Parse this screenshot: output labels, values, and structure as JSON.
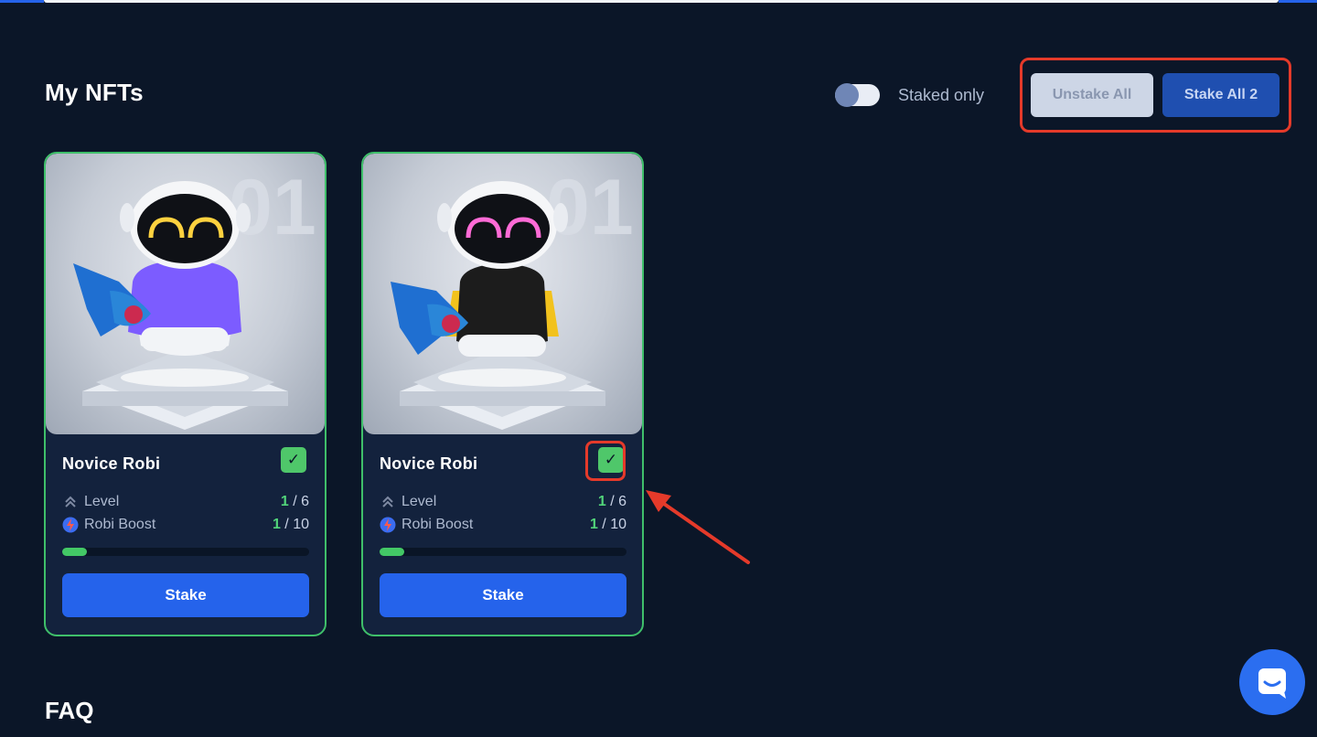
{
  "header": {
    "section_title": "My NFTs"
  },
  "filters": {
    "staked_only_label": "Staked only",
    "staked_only_on": false
  },
  "actions": {
    "unstake_all_label": "Unstake All",
    "stake_all_label": "Stake All 2"
  },
  "nfts": [
    {
      "name": "Novice Robi",
      "number_watermark": "01",
      "selected": true,
      "level_label": "Level",
      "level_current": "1",
      "level_max": " / 6",
      "boost_label": "Robi Boost",
      "boost_current": "1",
      "boost_max": " / 10",
      "progress": 0.1,
      "stake_label": "Stake",
      "outfit_color": "#7c5cff",
      "eye_color": "#ffd23f"
    },
    {
      "name": "Novice Robi",
      "number_watermark": "01",
      "selected": true,
      "level_label": "Level",
      "level_current": "1",
      "level_max": " / 6",
      "boost_label": "Robi Boost",
      "boost_current": "1",
      "boost_max": " / 10",
      "progress": 0.1,
      "stake_label": "Stake",
      "outfit_color": "#1c1c1c",
      "eye_color": "#ff6bd6"
    }
  ],
  "footer": {
    "faq_title": "FAQ"
  },
  "colors": {
    "accent": "#2563eb",
    "success": "#4fc76a",
    "annotation": "#e53a2a",
    "background": "#0b1628"
  },
  "icons": {
    "check": "check-icon",
    "level": "chevrons-up-icon",
    "boost": "lightning-icon",
    "chat": "chat-icon"
  }
}
